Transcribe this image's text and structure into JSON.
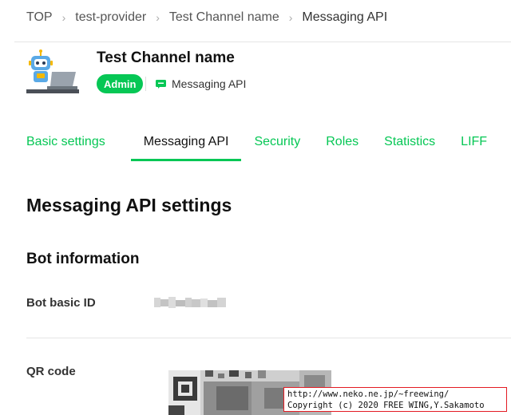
{
  "breadcrumb": {
    "items": [
      "TOP",
      "test-provider",
      "Test Channel name",
      "Messaging API"
    ]
  },
  "channel": {
    "name": "Test Channel name",
    "role_badge": "Admin",
    "type_label": "Messaging API"
  },
  "tabs": [
    {
      "label": "Basic settings",
      "active": false
    },
    {
      "label": "Messaging API",
      "active": true
    },
    {
      "label": "Security",
      "active": false
    },
    {
      "label": "Roles",
      "active": false
    },
    {
      "label": "Statistics",
      "active": false
    },
    {
      "label": "LIFF",
      "active": false
    }
  ],
  "main": {
    "title": "Messaging API settings",
    "bot_section_title": "Bot information",
    "bot_basic_id_label": "Bot basic ID",
    "qr_code_label": "QR code"
  },
  "watermark": {
    "line1": "http://www.neko.ne.jp/~freewing/",
    "line2": "Copyright (c) 2020 FREE WING,Y.Sakamoto"
  },
  "colors": {
    "accent": "#06c755",
    "watermark_border": "#e31b23"
  }
}
